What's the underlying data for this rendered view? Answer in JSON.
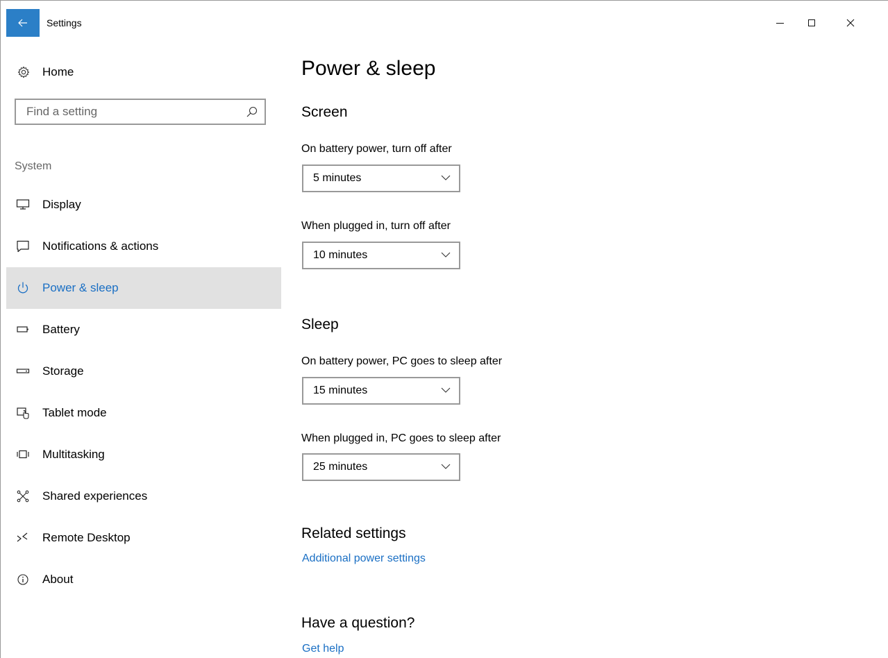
{
  "window": {
    "app_title": "Settings",
    "back_icon": "back-arrow-icon",
    "controls": {
      "minimize": "minimize-icon",
      "maximize": "maximize-icon",
      "close": "close-icon"
    }
  },
  "sidebar": {
    "home_label": "Home",
    "search_placeholder": "Find a setting",
    "section_label": "System",
    "items": [
      {
        "label": "Display",
        "icon": "monitor-icon",
        "active": false
      },
      {
        "label": "Notifications & actions",
        "icon": "notification-icon",
        "active": false
      },
      {
        "label": "Power & sleep",
        "icon": "power-icon",
        "active": true
      },
      {
        "label": "Battery",
        "icon": "battery-icon",
        "active": false
      },
      {
        "label": "Storage",
        "icon": "storage-icon",
        "active": false
      },
      {
        "label": "Tablet mode",
        "icon": "tablet-mode-icon",
        "active": false
      },
      {
        "label": "Multitasking",
        "icon": "multitasking-icon",
        "active": false
      },
      {
        "label": "Shared experiences",
        "icon": "shared-experiences-icon",
        "active": false
      },
      {
        "label": "Remote Desktop",
        "icon": "remote-desktop-icon",
        "active": false
      },
      {
        "label": "About",
        "icon": "info-icon",
        "active": false
      }
    ]
  },
  "main": {
    "title": "Power & sleep",
    "screen": {
      "heading": "Screen",
      "battery_label": "On battery power, turn off after",
      "battery_value": "5 minutes",
      "plugged_label": "When plugged in, turn off after",
      "plugged_value": "10 minutes"
    },
    "sleep": {
      "heading": "Sleep",
      "battery_label": "On battery power, PC goes to sleep after",
      "battery_value": "15 minutes",
      "plugged_label": "When plugged in, PC goes to sleep after",
      "plugged_value": "25 minutes"
    },
    "related": {
      "heading": "Related settings",
      "link": "Additional power settings"
    },
    "question": {
      "heading": "Have a question?",
      "link": "Get help"
    }
  },
  "colors": {
    "accent": "#1a6fc4",
    "titlebar_back": "#2b7fc7",
    "active_nav_bg": "#e1e1e1",
    "border": "#999999"
  }
}
